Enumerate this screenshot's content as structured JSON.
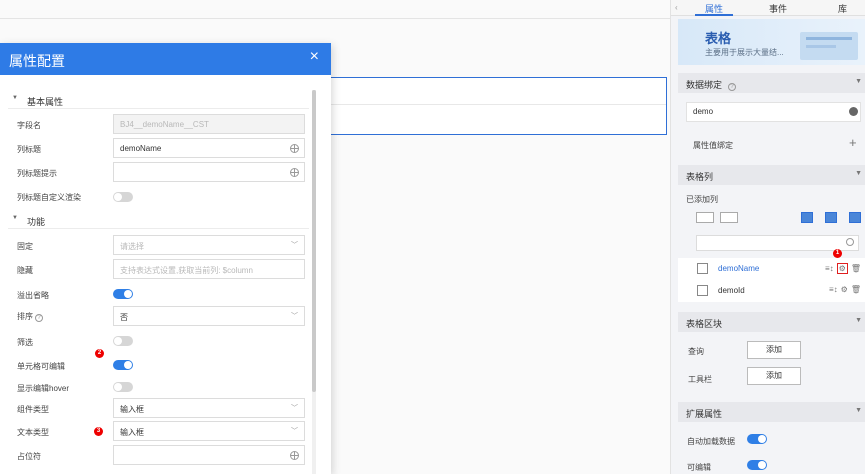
{
  "right_panel": {
    "tabs": [
      "属性",
      "事件",
      "库"
    ],
    "banner": {
      "title": "表格",
      "subtitle": "主要用于展示大量结..."
    },
    "data_binding": {
      "title": "数据绑定",
      "field_value": "demo",
      "attr_bind_label": "属性值绑定"
    },
    "table_columns": {
      "title": "表格列",
      "added_label": "已添加列",
      "columns": [
        {
          "name": "demoName",
          "highlighted": true
        },
        {
          "name": "demoId",
          "highlighted": false
        }
      ]
    },
    "table_blocks": {
      "title": "表格区块",
      "rows": [
        {
          "label": "查询",
          "button": "添加"
        },
        {
          "label": "工具栏",
          "button": "添加"
        }
      ]
    },
    "extended": {
      "title": "扩展属性",
      "rows": [
        {
          "label": "自动加载数据",
          "on": true
        },
        {
          "label": "可编辑",
          "on": true
        }
      ]
    }
  },
  "modal": {
    "title": "属性配置",
    "sections": {
      "basic": "基本属性",
      "func": "功能"
    },
    "basic": {
      "field_name_label": "字段名",
      "field_name_value": "BJ4__demoName__CST",
      "col_title_label": "列标题",
      "col_title_value": "demoName",
      "col_tip_label": "列标题提示",
      "col_custom_label": "列标题自定义渲染"
    },
    "func": {
      "fixed_label": "固定",
      "fixed_placeholder": "请选择",
      "hidden_label": "隐藏",
      "hidden_placeholder": "支持表达式设置,获取当前列: $column",
      "overflow_label": "溢出省略",
      "sort_label": "排序",
      "sort_value": "否",
      "filter_label": "筛选",
      "cell_edit_label": "单元格可编辑",
      "show_edit_hover_label": "显示编辑hover",
      "component_type_label": "组件类型",
      "component_type_value": "输入框",
      "text_type_label": "文本类型",
      "text_type_value": "输入框",
      "placeholder_label": "占位符"
    }
  },
  "badges": [
    "1",
    "2",
    "3"
  ],
  "colors": {
    "primary": "#2e7be6",
    "highlight": "#e02020"
  }
}
